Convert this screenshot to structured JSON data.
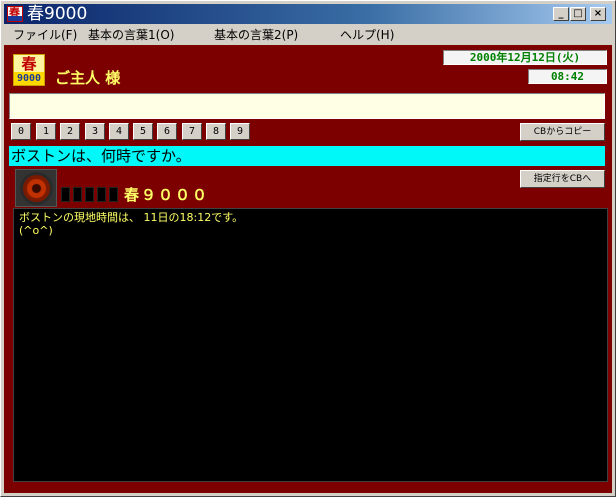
{
  "window": {
    "title": "春9000",
    "icon": "haru-app-icon",
    "controls": {
      "minimize": "_",
      "maximize": "□",
      "close": "×"
    }
  },
  "menu": [
    "ファイル(F)",
    "基本の言葉1(O)",
    "基本の言葉2(P)",
    "ヘルプ(H)"
  ],
  "logo": {
    "top": "春",
    "bottom": "9000"
  },
  "greeting": "ご主人 様",
  "date": "2000年12月12日(火)",
  "time": "08:42",
  "input": {
    "value": "",
    "placeholder": ""
  },
  "number_buttons": [
    "0",
    "1",
    "2",
    "3",
    "4",
    "5",
    "6",
    "7",
    "8",
    "9"
  ],
  "buttons": {
    "copy_from_cb": "CBからコピー",
    "line_to_cb": "指定行をCBへ"
  },
  "query": "ボストンは、何時ですか。",
  "ai_name": "春９０００",
  "output_lines": [
    "ボストンの現地時間は、 11日の18:12です。",
    "(^o^)"
  ],
  "colors": {
    "background": "#7d0000",
    "query_bar": "#00f8f8",
    "output_bg": "#000000",
    "text_yellow": "#ffff66",
    "clock_green": "#008000"
  }
}
